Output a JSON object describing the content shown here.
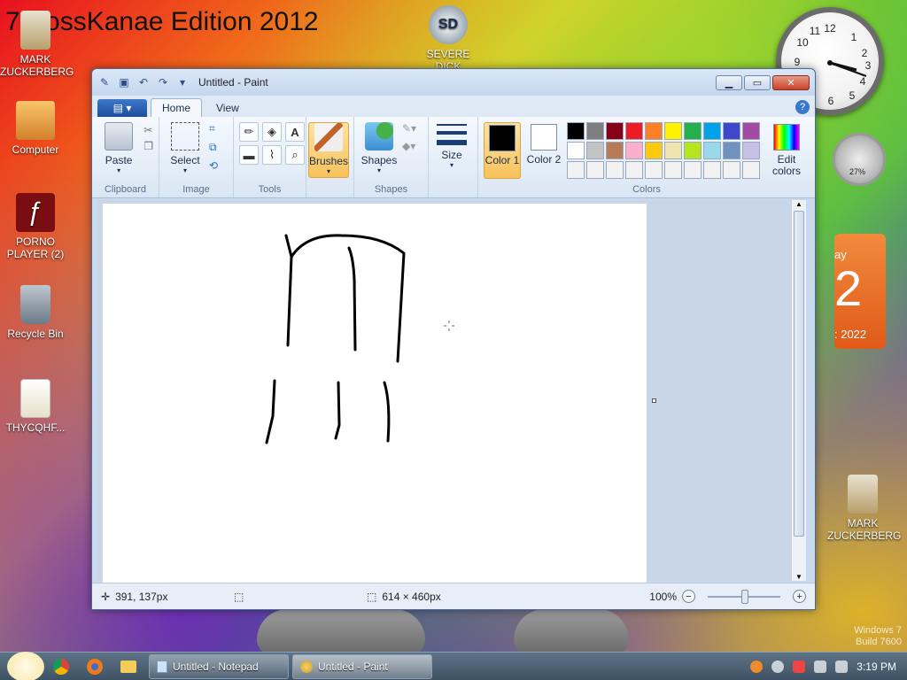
{
  "desktop": {
    "banner": "7 BossKanae Edition 2012",
    "icons": [
      {
        "label": "MARK ZUCKERBERG"
      },
      {
        "label": "Computer"
      },
      {
        "label": "PORNO PLAYER (2)"
      },
      {
        "label": "Recycle Bin"
      },
      {
        "label": "THYCQHF..."
      },
      {
        "label": "SEVERE DICK"
      },
      {
        "label": "MARK ZUCKERBERG"
      }
    ],
    "calendar": {
      "day_partial": "ay",
      "date": "2",
      "year_partial": ": 2022"
    },
    "meter": {
      "percent": "27%"
    },
    "watermark": [
      "Windows 7",
      "Build 7600"
    ]
  },
  "paint": {
    "title": "Untitled - Paint",
    "tabs": [
      "Home",
      "View"
    ],
    "groups": {
      "clipboard": {
        "label": "Clipboard",
        "paste": "Paste"
      },
      "image": {
        "label": "Image",
        "select": "Select"
      },
      "tools": {
        "label": "Tools"
      },
      "brushes": {
        "label": "Brushes"
      },
      "shapes": {
        "label": "Shapes",
        "button": "Shapes"
      },
      "size": {
        "label": "Size"
      },
      "colors": {
        "label": "Colors",
        "color1": "Color 1",
        "color2": "Color 2",
        "edit": "Edit colors"
      }
    },
    "palette": [
      "#000000",
      "#7f7f7f",
      "#880015",
      "#ed1c24",
      "#ff7f27",
      "#fff200",
      "#22b14c",
      "#00a2e8",
      "#3f48cc",
      "#a349a4",
      "#ffffff",
      "#c3c3c3",
      "#b97a57",
      "#ffaec9",
      "#ffc90e",
      "#efe4b0",
      "#b5e61d",
      "#99d9ea",
      "#7092be",
      "#c8bfe7",
      "#f2f2f2",
      "#f2f2f2",
      "#f2f2f2",
      "#f2f2f2",
      "#f2f2f2",
      "#f2f2f2",
      "#f2f2f2",
      "#f2f2f2",
      "#f2f2f2",
      "#f2f2f2"
    ],
    "color1": "#000000",
    "color2": "#ffffff",
    "status": {
      "cursor": "391, 137px",
      "canvas_size": "614 × 460px",
      "zoom": "100%"
    }
  },
  "taskbar": {
    "buttons": [
      {
        "label": "Untitled - Notepad"
      },
      {
        "label": "Untitled - Paint"
      }
    ],
    "time": "3:19 PM"
  }
}
